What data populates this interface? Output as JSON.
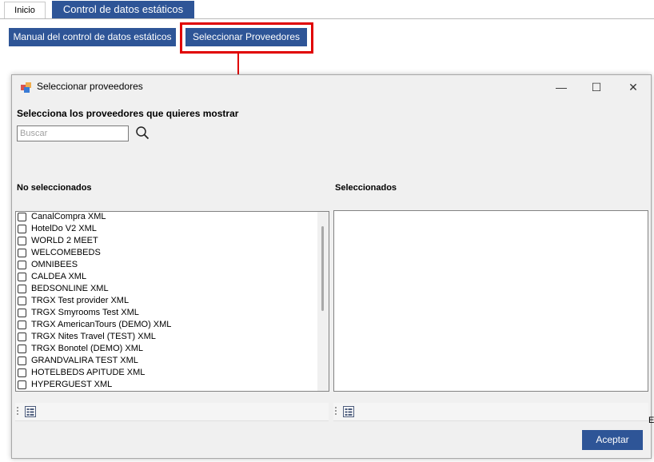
{
  "tabs": [
    {
      "label": "Inicio",
      "active": false
    },
    {
      "label": "Control de datos estáticos",
      "active": true
    }
  ],
  "toolbar": {
    "manual_label": "Manual del control de datos estáticos",
    "select_label": "Seleccionar Proveedores"
  },
  "dialog": {
    "title": "Seleccionar proveedores",
    "controls": {
      "minimize": "—",
      "maximize": "☐",
      "close": "✕"
    },
    "heading": "Selecciona los proveedores que quieres mostrar",
    "search": {
      "placeholder": "Buscar",
      "value": ""
    },
    "left_label": "No seleccionados",
    "right_label": "Seleccionados",
    "unselected_items": [
      "CanalCompra XML",
      "HotelDo V2 XML",
      "WORLD 2 MEET",
      "WELCOMEBEDS",
      "OMNIBEES",
      "CALDEA XML",
      "BEDSONLINE XML",
      "TRGX Test provider XML",
      "TRGX Smyrooms Test XML",
      "TRGX AmericanTours (DEMO) XML",
      "TRGX Nites Travel (TEST) XML",
      "TRGX Bonotel (DEMO) XML",
      "GRANDVALIRA TEST XML",
      "HOTELBEDS APITUDE XML",
      "HYPERGUEST XML"
    ],
    "selected_items": [],
    "accept_label": "Aceptar"
  },
  "stray_text": "E",
  "colors": {
    "accent": "#2e5597",
    "highlight": "#e00000"
  },
  "icons": [
    "app-icon",
    "search-icon",
    "list-view-icon"
  ]
}
